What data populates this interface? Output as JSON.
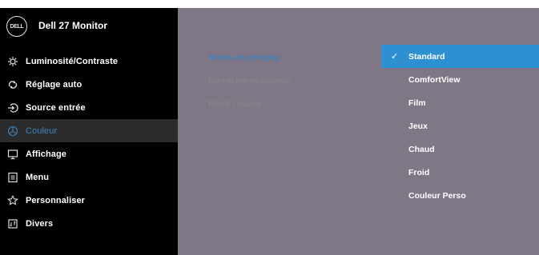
{
  "header": {
    "logo_text": "DELL",
    "model": "Dell 27 Monitor"
  },
  "menu": [
    {
      "label": "Luminosité/Contraste",
      "icon": "brightness-icon"
    },
    {
      "label": "Réglage auto",
      "icon": "auto-adjust-icon"
    },
    {
      "label": "Source entrée",
      "icon": "input-source-icon"
    },
    {
      "label": "Couleur",
      "icon": "color-icon",
      "active": true
    },
    {
      "label": "Affichage",
      "icon": "display-icon"
    },
    {
      "label": "Menu",
      "icon": "menu-icon"
    },
    {
      "label": "Personnaliser",
      "icon": "star-icon"
    },
    {
      "label": "Divers",
      "icon": "others-icon"
    }
  ],
  "submenu": [
    {
      "label": "Modes de préréglag",
      "active": true
    },
    {
      "label": "Format entrée couleurs"
    },
    {
      "label": "Réinit. Couleur"
    }
  ],
  "options": [
    {
      "label": "Standard",
      "selected": true,
      "check": "✓"
    },
    {
      "label": "ComfortView"
    },
    {
      "label": "Film"
    },
    {
      "label": "Jeux"
    },
    {
      "label": "Chaud"
    },
    {
      "label": "Froid"
    },
    {
      "label": "Couleur Perso"
    }
  ],
  "colors": {
    "panel": "#7f7785",
    "accent": "#2e8fd1",
    "active_text": "#3d86c6",
    "sidebar": "#000000"
  }
}
